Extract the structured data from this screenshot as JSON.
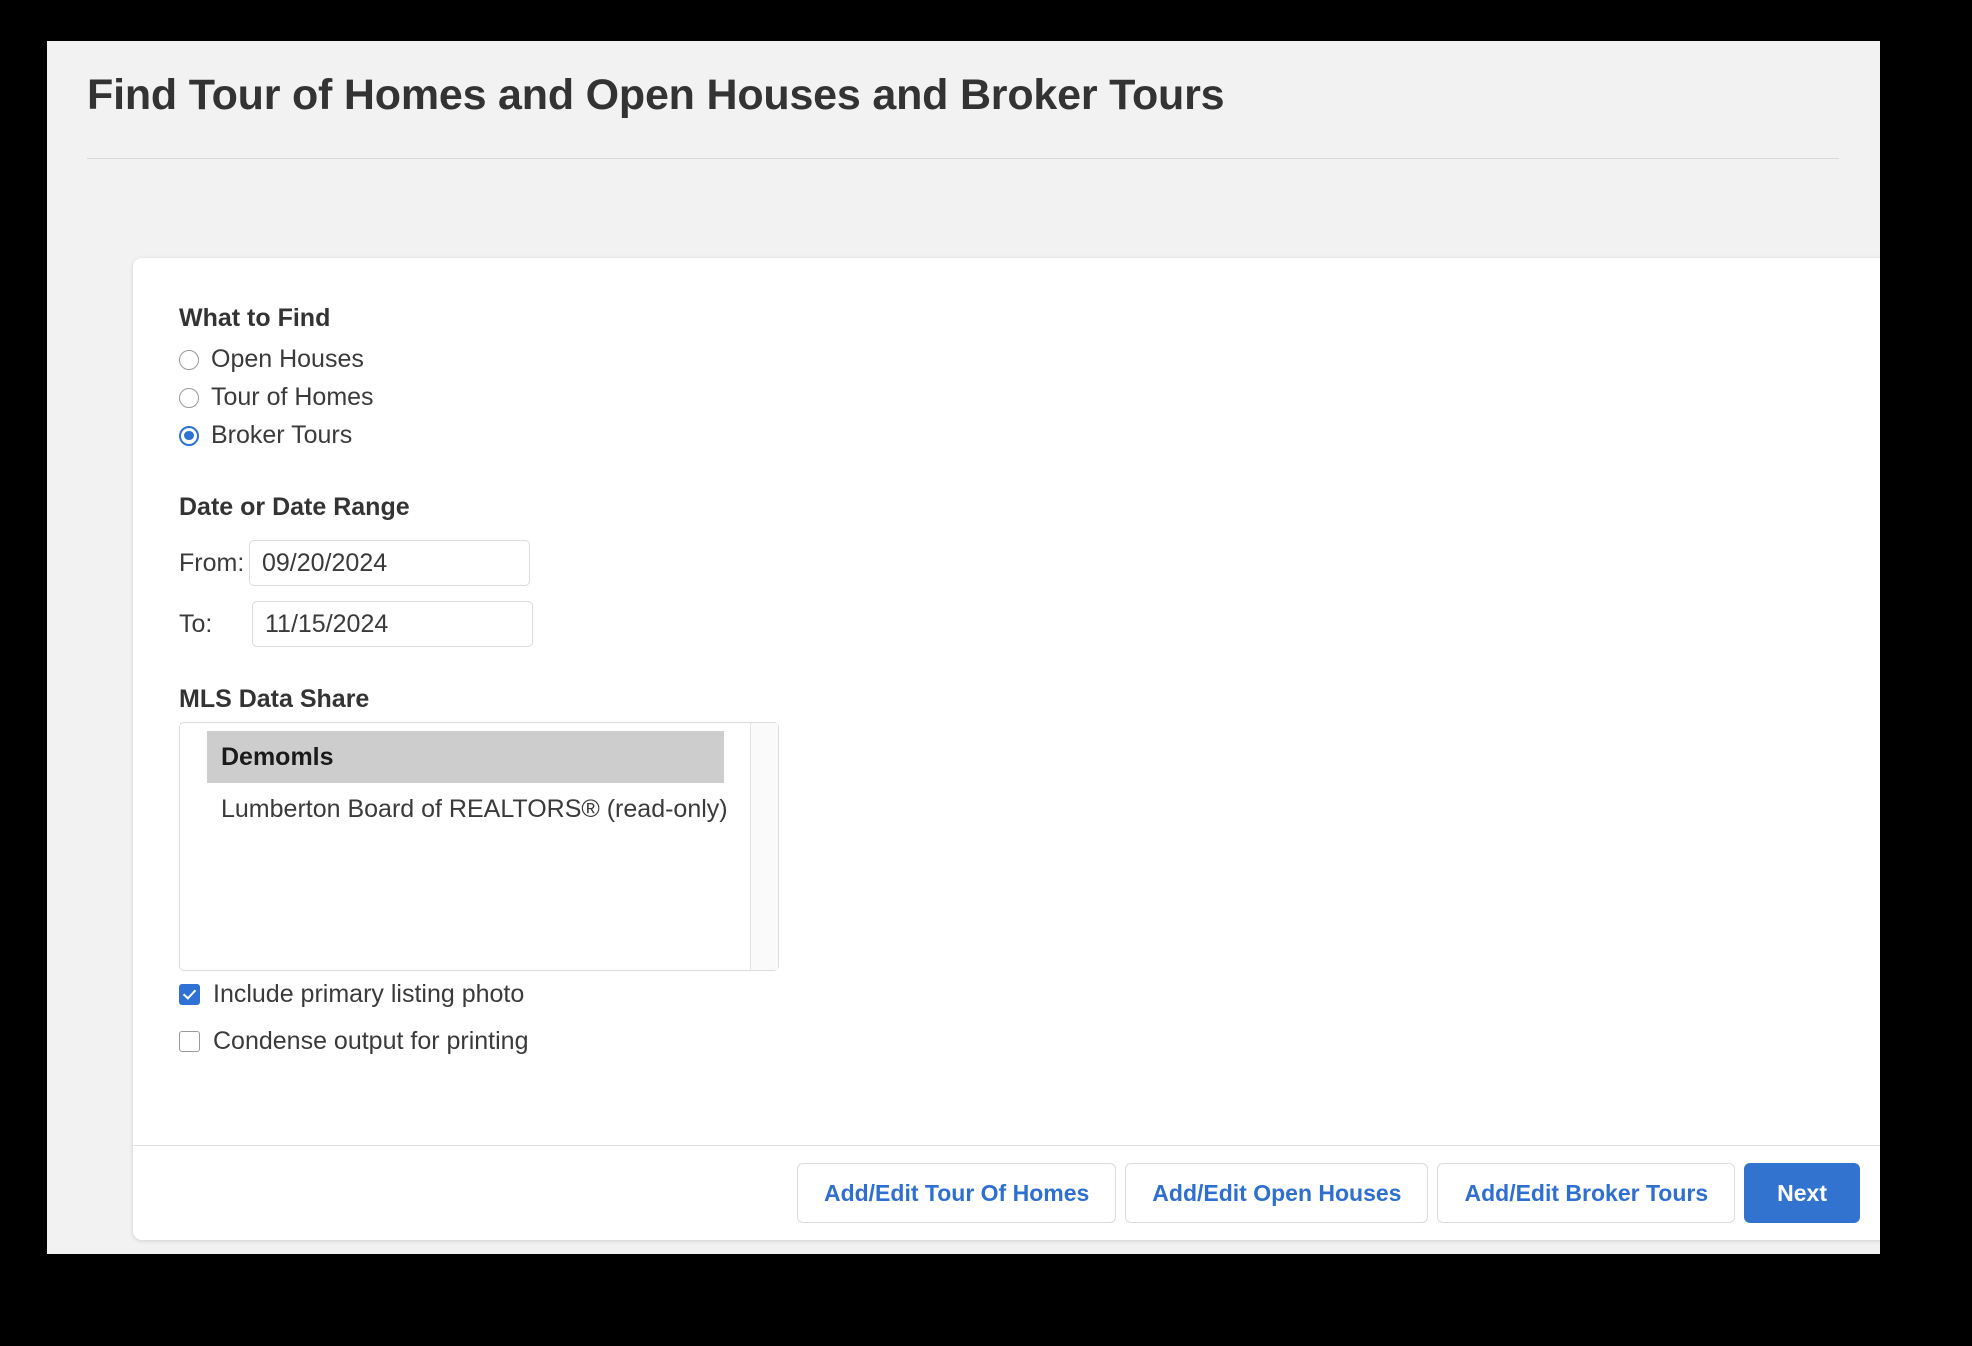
{
  "header": {
    "title": "Find Tour of Homes and Open Houses and Broker Tours"
  },
  "form": {
    "what_to_find": {
      "label": "What to Find",
      "options": [
        {
          "label": "Open Houses",
          "selected": false
        },
        {
          "label": "Tour of Homes",
          "selected": false
        },
        {
          "label": "Broker Tours",
          "selected": true
        }
      ]
    },
    "date_range": {
      "label": "Date or Date Range",
      "from_label": "From:",
      "from_value": "09/20/2024",
      "to_label": "To:",
      "to_value": "11/15/2024"
    },
    "mls_data_share": {
      "label": "MLS Data Share",
      "options": [
        {
          "label": "Demomls",
          "selected": true
        },
        {
          "label": "Lumberton Board of REALTORS® (read-only)",
          "selected": false
        }
      ]
    },
    "checkboxes": [
      {
        "label": "Include primary listing photo",
        "checked": true
      },
      {
        "label": "Condense output for printing",
        "checked": false
      }
    ]
  },
  "footer": {
    "buttons": [
      {
        "label": "Add/Edit Tour Of Homes",
        "style": "outline"
      },
      {
        "label": "Add/Edit Open Houses",
        "style": "outline"
      },
      {
        "label": "Add/Edit Broker Tours",
        "style": "outline"
      },
      {
        "label": "Next",
        "style": "primary"
      }
    ]
  },
  "colors": {
    "accent_blue": "#3273cf",
    "link_blue": "#2f6fd0",
    "page_background": "#f2f2f2",
    "card_background": "#ffffff",
    "selected_row": "#cdcdcd",
    "text": "#3a3a3a"
  }
}
